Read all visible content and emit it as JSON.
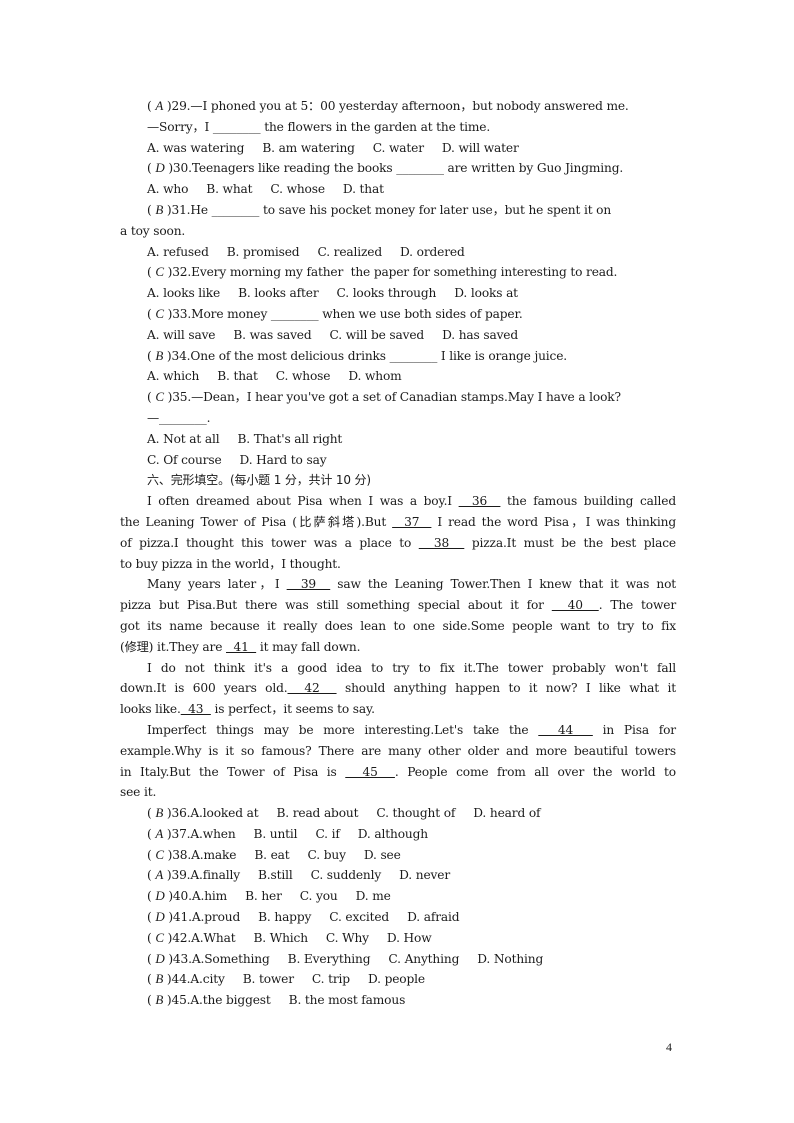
{
  "page_number": "4",
  "questions_part1": [
    {
      "answer": "A",
      "number": "29",
      "stem_lines": [
        "—I phoned you at 5：00 yesterday afternoon，but nobody answered me.",
        "—Sorry，I ________ the flowers in the garden at the time."
      ],
      "option_lines": [
        [
          "A. was watering",
          "B. am watering",
          "C. water",
          "D. will water"
        ]
      ]
    },
    {
      "answer": "D",
      "number": "30",
      "stem_lines": [
        "Teenagers like reading the books ________ are written by Guo Jingming."
      ],
      "option_lines": [
        [
          "A. who",
          "B. what",
          "C. whose",
          "D. that"
        ]
      ]
    },
    {
      "answer": "B",
      "number": "31",
      "stem_lines": [
        "He ________ to save his pocket money for later use，but he spent it on",
        "a toy soon."
      ],
      "option_lines": [
        [
          "A. refused",
          "B. promised",
          "C. realized",
          "D. ordered"
        ]
      ]
    },
    {
      "answer": "C",
      "number": "32",
      "stem_lines": [
        "Every morning my father  the paper for something interesting to read."
      ],
      "option_lines": [
        [
          "A. looks like",
          "B. looks after",
          "C. looks through",
          "D. looks at"
        ]
      ]
    },
    {
      "answer": "C",
      "number": "33",
      "stem_lines": [
        "More money ________ when we use both sides of paper."
      ],
      "option_lines": [
        [
          "A. will save",
          "B. was saved",
          "C. will be saved",
          "D. has saved"
        ]
      ]
    },
    {
      "answer": "B",
      "number": "34",
      "stem_lines": [
        "One of the most delicious drinks ________ I like is orange juice."
      ],
      "option_lines": [
        [
          "A. which",
          "B. that",
          "C. whose",
          "D. whom"
        ]
      ]
    },
    {
      "answer": "C",
      "number": "35",
      "stem_lines": [
        "—Dean，I hear you've got a set of Canadian stamps.May I have a look?",
        "—________."
      ],
      "option_lines": [
        [
          "A. Not at all",
          "B. That's all right"
        ],
        [
          "C. Of course",
          "D. Hard to say"
        ]
      ]
    }
  ],
  "section_title": "六、完形填空。(每小题 1 分，共计 10 分)",
  "passage": {
    "lines": [
      {
        "indent": true,
        "parts": [
          "I often dreamed about Pisa when I was a boy.I ",
          "36",
          " the famous building called"
        ]
      },
      {
        "indent": false,
        "parts": [
          "the Leaning Tower of Pisa (比萨斜塔).But ",
          "37",
          " I read the word Pisa，I was thinking"
        ]
      },
      {
        "indent": false,
        "parts": [
          "of pizza.I thought this tower was a place to ",
          "38",
          " pizza.It must be the best place"
        ]
      },
      {
        "indent": false,
        "last": true,
        "parts": [
          "to buy pizza in the world，I thought."
        ]
      },
      {
        "indent": true,
        "parts": [
          "Many years later，I ",
          "39",
          " saw the Leaning Tower.Then I knew that it was not"
        ]
      },
      {
        "indent": false,
        "parts": [
          "pizza but Pisa.But there was still something special about it for ",
          "40",
          ". The tower"
        ]
      },
      {
        "indent": false,
        "parts": [
          "got its name because it really does lean to one side.Some people want to try to fix"
        ]
      },
      {
        "indent": false,
        "last": true,
        "parts": [
          "(修理) it.They are ",
          "41",
          " it may fall down."
        ]
      },
      {
        "indent": true,
        "parts": [
          "I do not think it's a good idea to try to fix it.The tower probably won't fall"
        ]
      },
      {
        "indent": false,
        "parts": [
          "down.It is 600 years old.",
          "42",
          " should anything happen to it now? I like what it"
        ]
      },
      {
        "indent": false,
        "last": true,
        "parts": [
          "looks like.",
          "43",
          " is perfect，it seems to say."
        ]
      },
      {
        "indent": true,
        "parts": [
          "Imperfect things may be more interesting.Let's take the ",
          "44",
          " in Pisa for"
        ]
      },
      {
        "indent": false,
        "parts": [
          "example.Why is it so famous? There are many other older and more beautiful towers"
        ]
      },
      {
        "indent": false,
        "parts": [
          "in Italy.But the Tower of Pisa is ",
          "45",
          ". People come from all over the world to"
        ]
      },
      {
        "indent": false,
        "last": true,
        "parts": [
          "see it."
        ]
      }
    ]
  },
  "questions_part2": [
    {
      "answer": "B",
      "number": "36",
      "options": [
        "A.looked at",
        "B. read about",
        "C. thought of",
        "D. heard of"
      ]
    },
    {
      "answer": "A",
      "number": "37",
      "options": [
        "A.when",
        "B. until",
        "C. if",
        "D. although"
      ]
    },
    {
      "answer": "C",
      "number": "38",
      "options": [
        "A.make",
        "B. eat",
        "C. buy",
        "D. see"
      ]
    },
    {
      "answer": "A",
      "number": "39",
      "options": [
        "A.finally",
        "B.still",
        "C. suddenly",
        "D. never"
      ]
    },
    {
      "answer": "D",
      "number": "40",
      "options": [
        "A.him",
        "B. her",
        "C. you",
        "D. me"
      ]
    },
    {
      "answer": "D",
      "number": "41",
      "options": [
        "A.proud",
        "B. happy",
        "C. excited",
        "D. afraid"
      ]
    },
    {
      "answer": "C",
      "number": "42",
      "options": [
        "A.What",
        "B. Which",
        "C. Why",
        "D. How"
      ]
    },
    {
      "answer": "D",
      "number": "43",
      "options": [
        "A.Something",
        "B. Everything",
        "C. Anything",
        "D. Nothing"
      ]
    },
    {
      "answer": "B",
      "number": "44",
      "options": [
        "A.city",
        "B. tower",
        "C. trip",
        "D. people"
      ]
    },
    {
      "answer": "B",
      "number": "45",
      "options": [
        "A.the biggest",
        "B. the most famous"
      ]
    }
  ]
}
